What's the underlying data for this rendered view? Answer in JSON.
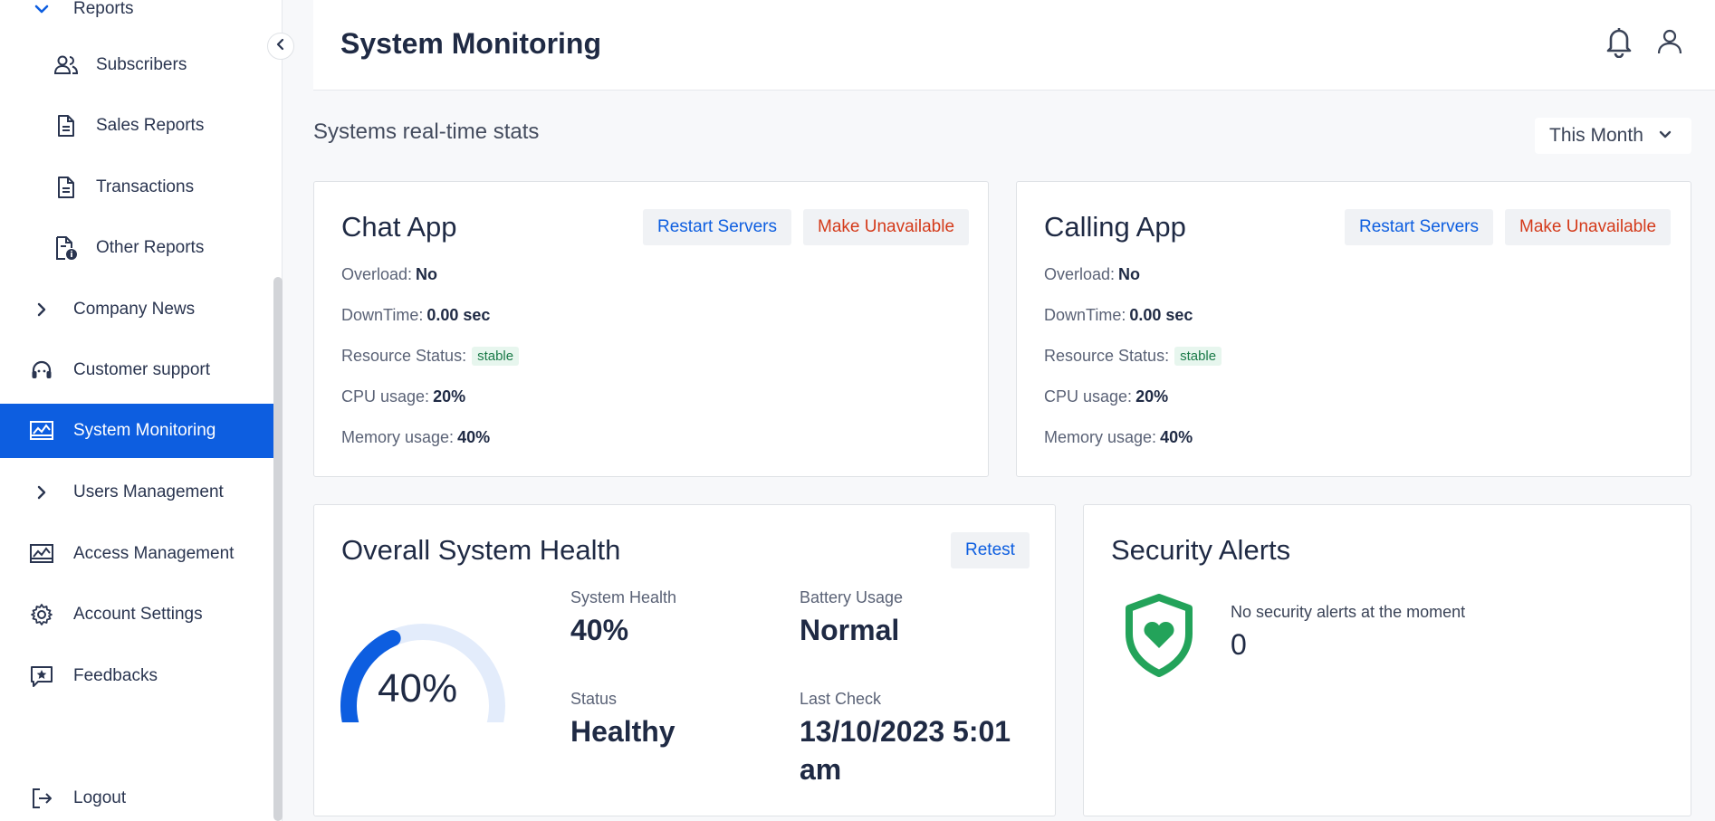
{
  "sidebar": {
    "reports": "Reports",
    "subscribers": "Subscribers",
    "sales_reports": "Sales Reports",
    "transactions": "Transactions",
    "other_reports": "Other Reports",
    "company_news": "Company News",
    "customer_support": "Customer support",
    "system_monitoring": "System Monitoring",
    "users_management": "Users Management",
    "access_management": "Access Management",
    "account_settings": "Account Settings",
    "feedbacks": "Feedbacks",
    "logout": "Logout"
  },
  "header": {
    "title": "System Monitoring"
  },
  "main": {
    "section_title": "Systems real-time stats",
    "period": "This Month"
  },
  "apps": [
    {
      "name": "Chat App",
      "restart_label": "Restart Servers",
      "unavailable_label": "Make Unavailable",
      "overload_label": "Overload:",
      "overload": "No",
      "downtime_label": "DownTime:",
      "downtime": "0.00 sec",
      "resource_label": "Resource Status:",
      "resource": "stable",
      "cpu_label": "CPU usage:",
      "cpu": "20%",
      "memory_label": "Memory usage:",
      "memory": "40%"
    },
    {
      "name": "Calling App",
      "restart_label": "Restart Servers",
      "unavailable_label": "Make Unavailable",
      "overload_label": "Overload:",
      "overload": "No",
      "downtime_label": "DownTime:",
      "downtime": "0.00 sec",
      "resource_label": "Resource Status:",
      "resource": "stable",
      "cpu_label": "CPU usage:",
      "cpu": "20%",
      "memory_label": "Memory usage:",
      "memory": "40%"
    }
  ],
  "health": {
    "title": "Overall System Health",
    "retest_label": "Retest",
    "gauge_value": 0.4,
    "gauge_text": "40%",
    "system_health_label": "System Health",
    "system_health": "40%",
    "battery_label": "Battery Usage",
    "battery": "Normal",
    "status_label": "Status",
    "status": "Healthy",
    "last_check_label": "Last Check",
    "last_check_line1": "13/10/2023 5:01",
    "last_check_line2": "am"
  },
  "security": {
    "title": "Security Alerts",
    "message": "No security alerts at the moment",
    "count": "0"
  },
  "colors": {
    "accent": "#0d5ee0",
    "danger": "#d43a1a",
    "success": "#23a35a",
    "gauge_track": "#e3ecfb"
  },
  "icons": [
    "chevron-down-icon",
    "users-icon",
    "document-icon",
    "document-info-icon",
    "chevron-right-icon",
    "headset-icon",
    "chart-monitor-icon",
    "gear-icon",
    "feedback-star-icon",
    "logout-icon",
    "bell-icon",
    "user-icon",
    "chevron-left-icon",
    "shield-heart-icon"
  ]
}
